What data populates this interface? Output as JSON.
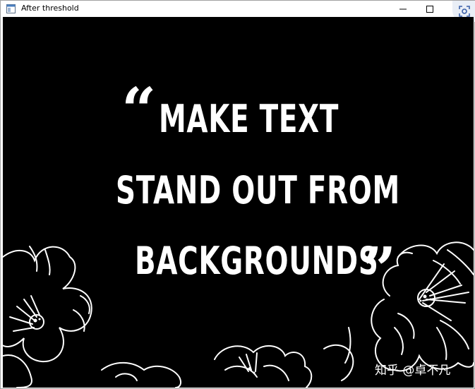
{
  "window": {
    "title": "After threshold"
  },
  "image": {
    "quote_open": "“",
    "line1": "MAKE TEXT",
    "line2": "STAND OUT FROM",
    "line3": "BACKGROUNDS",
    "quote_close": "”",
    "watermark": "知乎 @卓不凡"
  },
  "colors": {
    "canvas_bg": "#000000",
    "foreground": "#ffffff"
  },
  "icons": {
    "app": "window-app-icon",
    "minimize": "minimize-icon",
    "maximize": "maximize-icon",
    "screenshot": "screenshot-lens-icon"
  }
}
